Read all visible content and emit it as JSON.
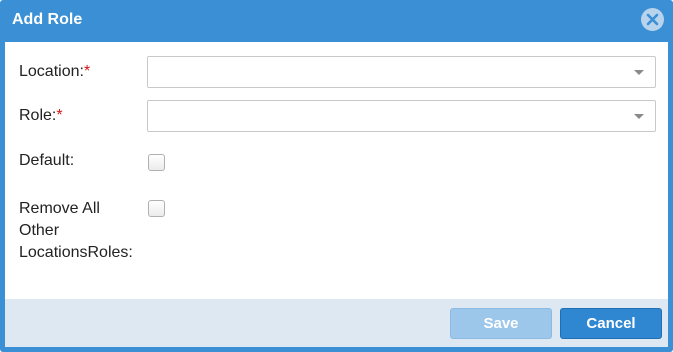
{
  "dialog": {
    "title": "Add Role"
  },
  "form": {
    "location": {
      "label": "Location:",
      "required_mark": "*",
      "value": ""
    },
    "role": {
      "label": "Role:",
      "required_mark": "*",
      "value": ""
    },
    "default": {
      "label": "Default:",
      "checked": false
    },
    "remove_all": {
      "label_line1": "Remove All",
      "label_line2": "Other",
      "label_line3": "LocationsRoles:",
      "checked": false
    }
  },
  "footer": {
    "save_label": "Save",
    "cancel_label": "Cancel"
  },
  "icons": {
    "close": "close-icon",
    "dropdown": "chevron-down-icon"
  },
  "colors": {
    "title_bar": "#3a8fd5",
    "footer": "#dde8f3",
    "required": "#d41515",
    "save_disabled": "#9cc7ea",
    "cancel": "#2f87d1"
  }
}
